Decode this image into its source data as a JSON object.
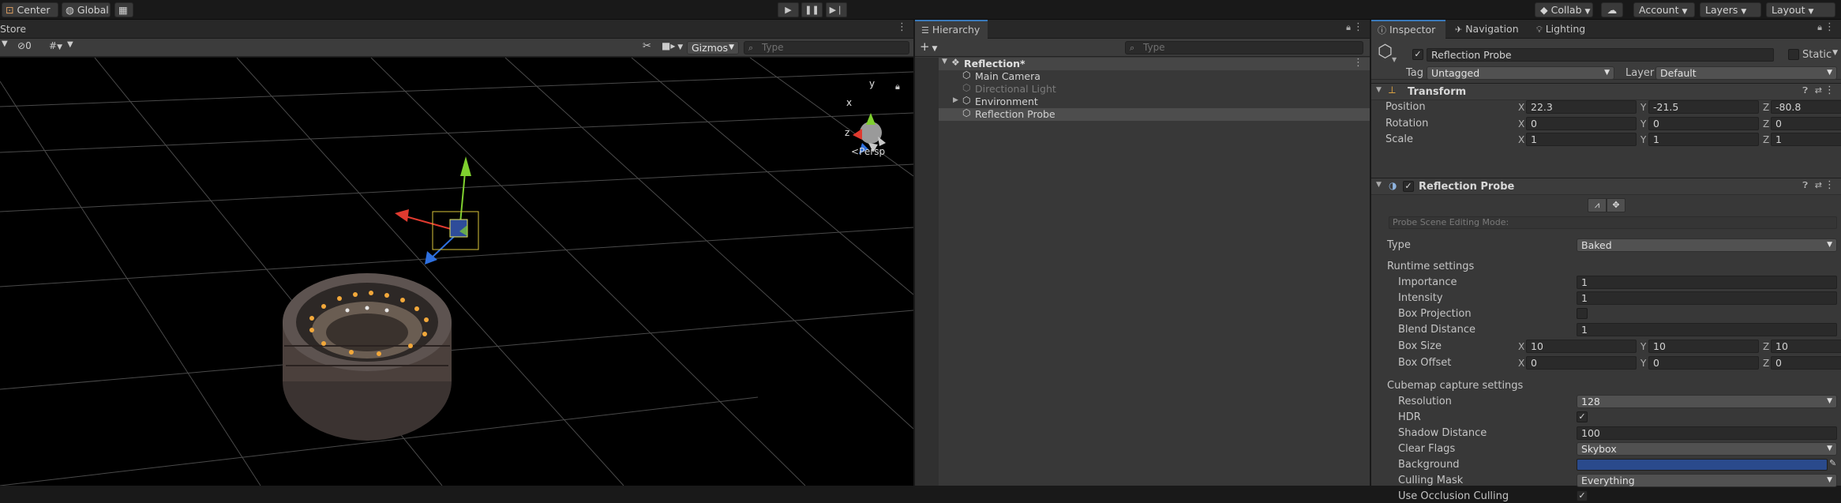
{
  "topbar": {
    "pivot_label": "Center",
    "space_label": "Global",
    "collab_label": "Collab",
    "account_label": "Account",
    "layers_label": "Layers",
    "layout_label": "Layout"
  },
  "scene": {
    "tab_label": "Store",
    "hidden_count": "0",
    "gizmos_label": "Gizmos",
    "search_placeholder": "Type",
    "axis_y": "y",
    "axis_x": "x",
    "axis_z": "z",
    "projection_label": "Persp"
  },
  "hierarchy": {
    "tab_label": "Hierarchy",
    "add_label": "+",
    "search_placeholder": "Type",
    "scene_name": "Reflection*",
    "items": [
      {
        "label": "Main Camera",
        "disabled": false,
        "expandable": false,
        "selected": false
      },
      {
        "label": "Directional Light",
        "disabled": true,
        "expandable": false,
        "selected": false
      },
      {
        "label": "Environment",
        "disabled": false,
        "expandable": true,
        "selected": false
      },
      {
        "label": "Reflection Probe",
        "disabled": false,
        "expandable": false,
        "selected": true
      }
    ]
  },
  "inspector": {
    "tabs": [
      "Inspector",
      "Navigation",
      "Lighting"
    ],
    "object_name": "Reflection Probe",
    "static_label": "Static",
    "tag_label": "Tag",
    "tag_value": "Untagged",
    "layer_label": "Layer",
    "layer_value": "Default",
    "transform": {
      "title": "Transform",
      "position_label": "Position",
      "rotation_label": "Rotation",
      "scale_label": "Scale",
      "position": [
        "22.3",
        "-21.5",
        "-80.8"
      ],
      "rotation": [
        "0",
        "0",
        "0"
      ],
      "scale": [
        "1",
        "1",
        "1"
      ]
    },
    "probe": {
      "title": "Reflection Probe",
      "edit_mode_label": "Probe Scene Editing Mode:",
      "type_label": "Type",
      "type_value": "Baked",
      "runtime_section": "Runtime settings",
      "importance_label": "Importance",
      "importance_value": "1",
      "intensity_label": "Intensity",
      "intensity_value": "1",
      "box_projection_label": "Box Projection",
      "blend_distance_label": "Blend Distance",
      "blend_distance_value": "1",
      "box_size_label": "Box Size",
      "box_size": [
        "10",
        "10",
        "10"
      ],
      "box_offset_label": "Box Offset",
      "box_offset": [
        "0",
        "0",
        "0"
      ],
      "cubemap_section": "Cubemap capture settings",
      "resolution_label": "Resolution",
      "resolution_value": "128",
      "hdr_label": "HDR",
      "shadow_distance_label": "Shadow Distance",
      "shadow_distance_value": "100",
      "clear_flags_label": "Clear Flags",
      "clear_flags_value": "Skybox",
      "background_label": "Background",
      "background_color": "#2a4a8c",
      "culling_mask_label": "Culling Mask",
      "culling_mask_value": "Everything",
      "occlusion_label": "Use Occlusion Culling"
    }
  },
  "axis_labels": {
    "x": "X",
    "y": "Y",
    "z": "Z"
  },
  "colors": {
    "accent": "#3a79bb",
    "selected_row": "#4d4d4d",
    "gizmo_x": "#e03a2f",
    "gizmo_y": "#7fd02f",
    "gizmo_z": "#2e70e0"
  }
}
